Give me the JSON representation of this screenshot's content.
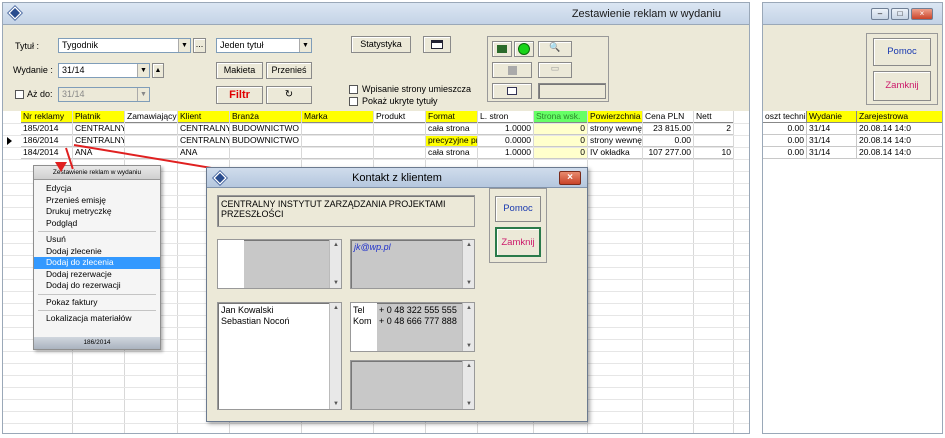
{
  "main_window": {
    "title": "Zestawienie reklam w wydaniu",
    "tytul_label": "Tytuł :",
    "tytul_value": "Tygodnik",
    "tytul_more": "...",
    "jeden_tytul_value": "Jeden tytuł",
    "statystyka_label": "Statystyka",
    "wydanie_label": "Wydanie :",
    "wydanie_value": "31/14",
    "makieta_label": "Makieta",
    "przenies_label": "Przenieś",
    "az_do_label": "Aż do:",
    "az_do_value": "31/14",
    "filtr_label": "Filtr",
    "wpisanie_label": "Wpisanie strony umieszcza",
    "pokaz_label": "Pokaż ukryte tytuły",
    "columns": [
      "Nr reklamy",
      "Płatnik",
      "Zamawiający",
      "Klient",
      "Branża",
      "Marka",
      "Produkt",
      "Format",
      "L. stron",
      "Strona wsk.",
      "Powierzchnia",
      "Cena PLN",
      "Nett"
    ],
    "rows": [
      {
        "nr": "185/2014",
        "platnik": "CENTRALNY IN",
        "zam": "",
        "klient": "CENTRALNY IN",
        "branza": "BUDOWNICTWO",
        "marka": "",
        "produkt": "",
        "format": "cała strona",
        "lstron": "1.0000",
        "strona": "0",
        "pow": "strony wewnę",
        "cena": "23 815.00",
        "nett": "2"
      },
      {
        "nr": "186/2014",
        "platnik": "CENTRALNY IN",
        "zam": "",
        "klient": "CENTRALNY IN",
        "branza": "BUDOWNICTWO",
        "marka": "",
        "produkt": "",
        "format": "precyzyjne prz",
        "lstron": "0.0000",
        "strona": "0",
        "pow": "strony wewnę",
        "cena": "0.00",
        "nett": ""
      },
      {
        "nr": "184/2014",
        "platnik": "ANA",
        "zam": "",
        "klient": "ANA",
        "branza": "",
        "marka": "",
        "produkt": "",
        "format": "cała strona",
        "lstron": "1.0000",
        "strona": "0",
        "pow": "IV okładka",
        "cena": "107 277.00",
        "nett": "10"
      }
    ]
  },
  "context_menu": {
    "header": "Zestawienie reklam w wydaniu",
    "items": [
      "Edycja",
      "Przenieś emisję",
      "Drukuj metryczkę",
      "Podgląd",
      "Usuń",
      "Dodaj zlecenie",
      "Dodaj do zlecenia",
      "Dodaj rezerwacje",
      "Dodaj do rezerwacji",
      "Pokaz faktury",
      "Lokalizacja materiałów"
    ],
    "selected_index": 6,
    "footer": "186/2014"
  },
  "dialog": {
    "title": "Kontakt z klientem",
    "close": "×",
    "company": "CENTRALNY INSTYTUT ZARZĄDZANIA PROJEKTAMI PRZESZŁOŚCI",
    "email": "jk@wp.pl",
    "contacts": [
      "Jan Kowalski",
      "Sebastian Nocoń"
    ],
    "phones": [
      {
        "type": "Tel",
        "number": "+ 0 48 322 555 555"
      },
      {
        "type": "Kom",
        "number": "+ 0 48 666 777 888"
      }
    ],
    "pomoc_label": "Pomoc",
    "zamknij_label": "Zamknij"
  },
  "right_window": {
    "pomoc_label": "Pomoc",
    "zamknij_label": "Zamknij",
    "columns": [
      "oszt technic",
      "Wydanie",
      "Zarejestrowa"
    ],
    "rows": [
      {
        "koszt": "0.00",
        "wydanie": "31/14",
        "zarej": "20.08.14 14:0"
      },
      {
        "koszt": "0.00",
        "wydanie": "31/14",
        "zarej": "20.08.14 14:0"
      },
      {
        "koszt": "0.00",
        "wydanie": "31/14",
        "zarej": "20.08.14 14:0"
      }
    ],
    "win_min": "–",
    "win_max": "□",
    "win_close": "×"
  },
  "colors": {
    "header_yellow": "#ffff00",
    "highlight_green": "#66ff66",
    "arrow_red": "#e02020",
    "menu_select": "#3399ff"
  }
}
